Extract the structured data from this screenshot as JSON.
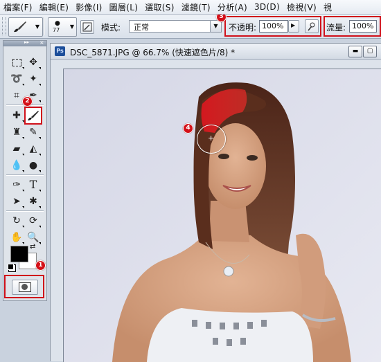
{
  "menu": [
    "檔案(F)",
    "編輯(E)",
    "影像(I)",
    "圖層(L)",
    "選取(S)",
    "濾鏡(T)",
    "分析(A)",
    "3D(D)",
    "檢視(V)",
    "視"
  ],
  "options": {
    "brush_size": "77",
    "mode_label": "模式:",
    "mode_value": "正常",
    "opacity_label": "不透明:",
    "opacity_value": "100%",
    "flow_label": "流量:",
    "flow_value": "100%"
  },
  "badges": {
    "b1": "1",
    "b2": "2",
    "b3": "3",
    "b4": "4"
  },
  "document": {
    "ps_icon": "Ps",
    "title": "DSC_5871.JPG @ 66.7% (快速遮色片/8) *"
  },
  "colors": {
    "highlight": "#d0101a",
    "mask_paint": "#e8141f",
    "foreground": "#000000",
    "background": "#ffffff"
  },
  "icons": [
    "brush-icon",
    "brush-preset-icon",
    "airbrush-icon",
    "marquee-icon",
    "move-icon",
    "lasso-icon",
    "magic-wand-icon",
    "crop-icon",
    "eyedropper-icon",
    "healing-icon",
    "brush-tool-icon",
    "stamp-icon",
    "history-brush-icon",
    "eraser-icon",
    "bucket-icon",
    "blur-icon",
    "dodge-icon",
    "pen-icon",
    "type-icon",
    "path-select-icon",
    "shape-icon",
    "3d-rotate-icon",
    "3d-orbit-icon",
    "hand-icon",
    "zoom-icon",
    "swap-colors-icon",
    "default-colors-icon",
    "quick-mask-icon",
    "brush-cursor-icon"
  ]
}
